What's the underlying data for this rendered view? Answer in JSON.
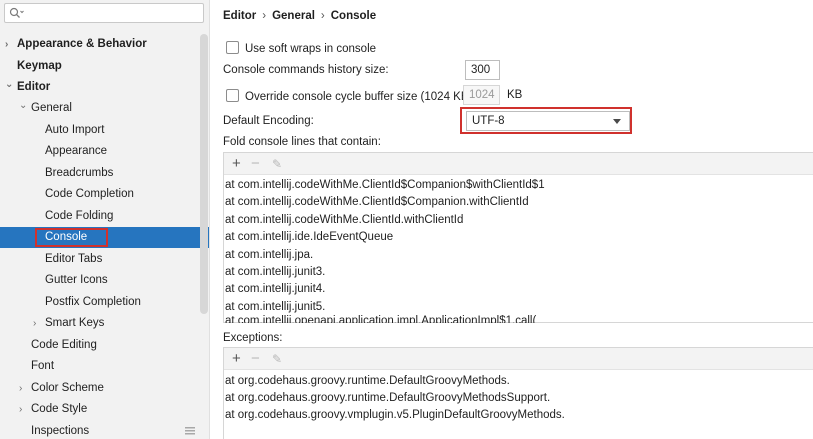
{
  "sidebar": {
    "search_placeholder": "",
    "items": [
      {
        "label": "Appearance & Behavior",
        "arrow": "›"
      },
      {
        "label": "Keymap"
      },
      {
        "label": "Editor",
        "arrow": "⌄"
      },
      {
        "label": "General",
        "arrow": "⌄"
      },
      {
        "label": "Auto Import"
      },
      {
        "label": "Appearance"
      },
      {
        "label": "Breadcrumbs"
      },
      {
        "label": "Code Completion"
      },
      {
        "label": "Code Folding"
      },
      {
        "label": "Console"
      },
      {
        "label": "Editor Tabs"
      },
      {
        "label": "Gutter Icons"
      },
      {
        "label": "Postfix Completion"
      },
      {
        "label": "Smart Keys",
        "arrow": "›"
      },
      {
        "label": "Code Editing"
      },
      {
        "label": "Font"
      },
      {
        "label": "Color Scheme",
        "arrow": "›"
      },
      {
        "label": "Code Style",
        "arrow": "›"
      },
      {
        "label": "Inspections"
      }
    ]
  },
  "breadcrumb": {
    "part1": "Editor",
    "sep": "›",
    "part2": "General",
    "part3": "Console"
  },
  "console": {
    "soft_wraps_label": "Use soft wraps in console",
    "history_label": "Console commands history size:",
    "history_value": "300",
    "override_label": "Override console cycle buffer size (1024 KB)",
    "buffer_value": "1024",
    "buffer_unit": "KB",
    "encoding_label": "Default Encoding:",
    "encoding_value": "UTF-8",
    "fold_label": "Fold console lines that contain:",
    "fold_lines": [
      "at com.intellij.codeWithMe.ClientId$Companion$withClientId$1",
      "at com.intellij.codeWithMe.ClientId$Companion.withClientId",
      "at com.intellij.codeWithMe.ClientId.withClientId",
      "at com.intellij.ide.IdeEventQueue",
      "at com.intellij.jpa.",
      "at com.intellij.junit3.",
      "at com.intellij.junit4.",
      "at com.intellij.junit5.",
      "at com.intellij.openapi.application.impl.ApplicationImpl$1.call("
    ],
    "exceptions_label": "Exceptions:",
    "exception_lines": [
      "at org.codehaus.groovy.runtime.DefaultGroovyMethods.",
      "at org.codehaus.groovy.runtime.DefaultGroovyMethodsSupport.",
      "at org.codehaus.groovy.vmplugin.v5.PluginDefaultGroovyMethods."
    ],
    "toolbar": {
      "add": "+",
      "remove": "−",
      "edit": "✎"
    }
  },
  "colors": {
    "selection": "#2675bf",
    "highlight_box": "#d0312d"
  }
}
